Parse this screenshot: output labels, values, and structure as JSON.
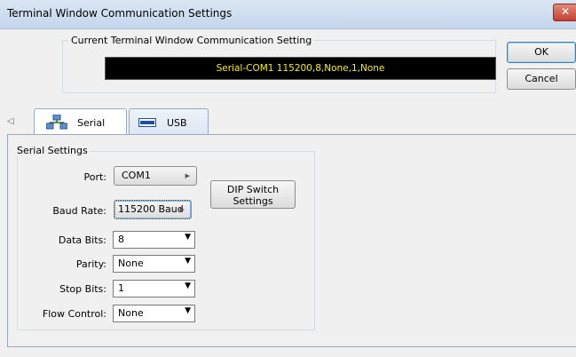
{
  "window": {
    "title": "Terminal Window Communication Settings",
    "close_glyph": "✕"
  },
  "current": {
    "legend": "Current Terminal Window Communication Setting",
    "value": "Serial-COM1 115200,8,None,1,None"
  },
  "buttons": {
    "ok": "OK",
    "cancel": "Cancel",
    "dip_line1": "DIP Switch",
    "dip_line2": "Settings"
  },
  "tabs": [
    {
      "label": "Serial",
      "icon": "network-icon"
    },
    {
      "label": "USB",
      "icon": "usb-icon"
    }
  ],
  "serial": {
    "legend": "Serial Settings",
    "port": {
      "label": "Port:",
      "value": "COM1"
    },
    "baud": {
      "label": "Baud Rate:",
      "value": "115200 Baud"
    },
    "data_bits": {
      "label": "Data Bits:",
      "value": "8"
    },
    "parity": {
      "label": "Parity:",
      "value": "None"
    },
    "stop_bits": {
      "label": "Stop Bits:",
      "value": "1"
    },
    "flow_control": {
      "label": "Flow Control:",
      "value": "None"
    }
  }
}
